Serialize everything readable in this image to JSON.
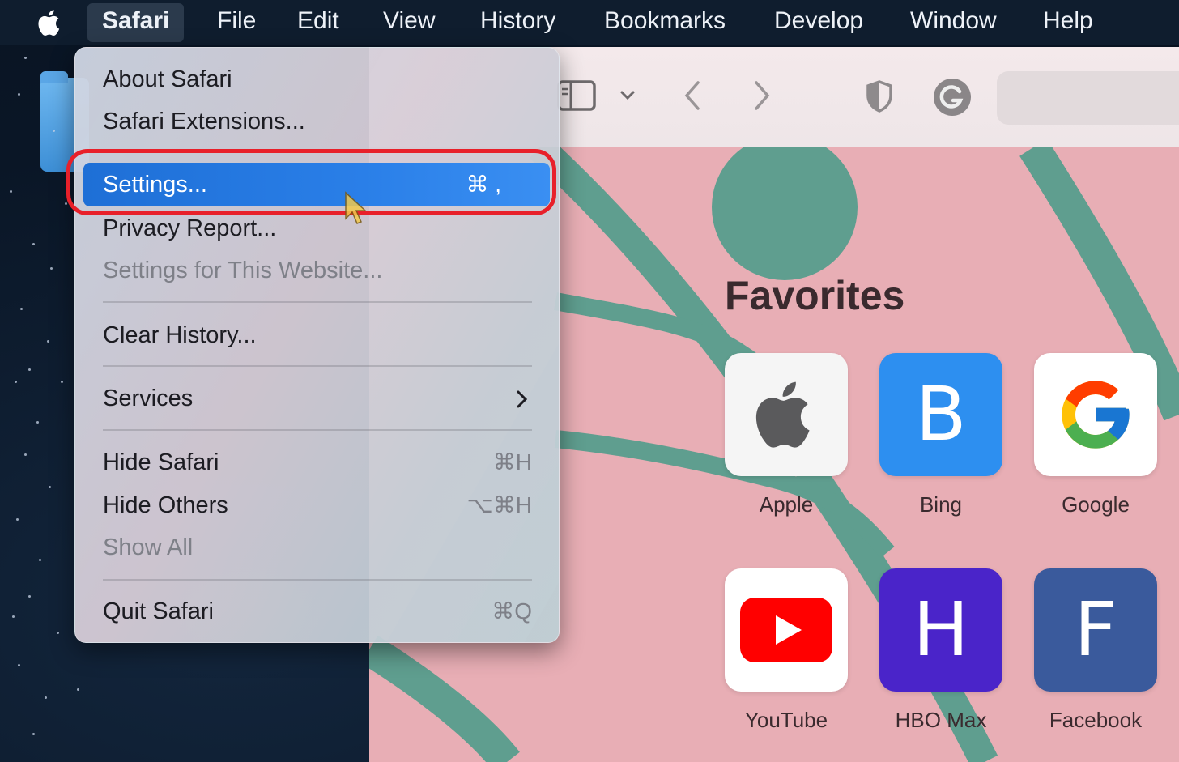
{
  "menubar": {
    "app_name": "Safari",
    "items": [
      "File",
      "Edit",
      "View",
      "History",
      "Bookmarks",
      "Develop",
      "Window",
      "Help"
    ]
  },
  "safari_menu": {
    "about": "About Safari",
    "extensions": "Safari Extensions...",
    "settings": "Settings...",
    "settings_shortcut": "⌘ ,",
    "privacy_report": "Privacy Report...",
    "settings_website": "Settings for This Website...",
    "clear_history": "Clear History...",
    "services": "Services",
    "hide_safari": "Hide Safari",
    "hide_safari_shortcut": "⌘H",
    "hide_others": "Hide Others",
    "hide_others_shortcut": "⌥⌘H",
    "show_all": "Show All",
    "quit": "Quit Safari",
    "quit_shortcut": "⌘Q"
  },
  "start_page": {
    "favorites_title": "Favorites",
    "favorites": [
      {
        "label": "Apple",
        "icon": "apple-logo-icon",
        "color": "#f5f5f5"
      },
      {
        "label": "Bing",
        "letter": "B",
        "color": "#2d8ff0"
      },
      {
        "label": "Google",
        "icon": "google-g-icon",
        "color": "#ffffff"
      },
      {
        "label": "YouTube",
        "icon": "youtube-play-icon",
        "color": "#ffffff"
      },
      {
        "label": "HBO Max",
        "letter": "H",
        "color": "#4a24c9"
      },
      {
        "label": "Facebook",
        "letter": "F",
        "color": "#3a5a9c"
      }
    ]
  },
  "colors": {
    "highlight": "#2a7fe8",
    "annotation_ring": "#e8202a",
    "page_background": "#e8aeb5",
    "leaf_green": "#5f9e8f"
  }
}
